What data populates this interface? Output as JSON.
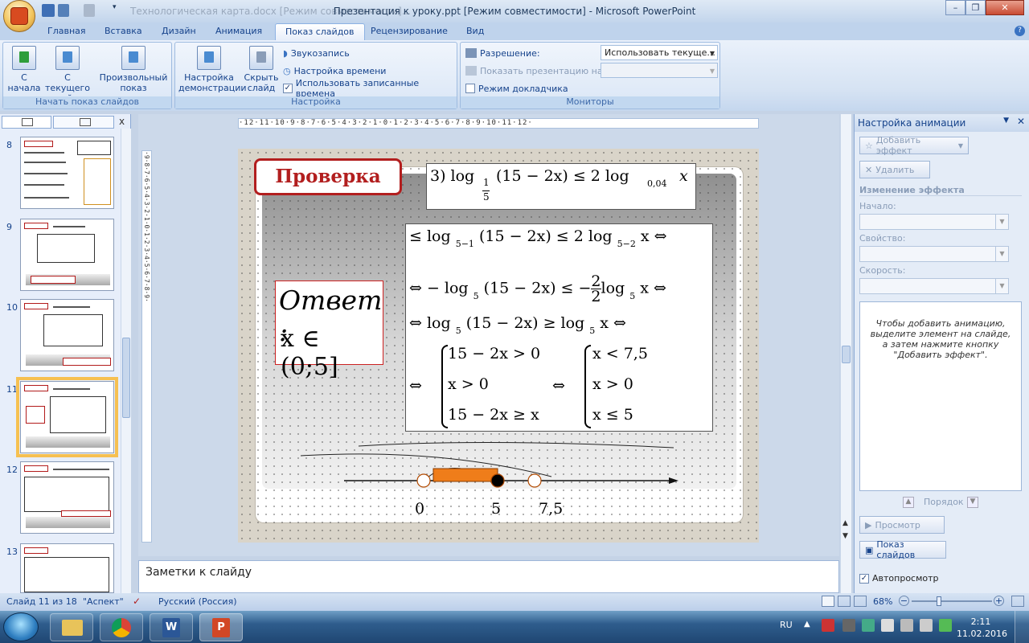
{
  "window": {
    "title": "Презентация к уроку.ppt [Режим совместимости] - Microsoft PowerPoint",
    "title_faded": "Технологическая карта.docx [Режим совместимости]..."
  },
  "tabs": [
    "Главная",
    "Вставка",
    "Дизайн",
    "Анимация",
    "Показ слайдов",
    "Рецензирование",
    "Вид"
  ],
  "active_tab": "Показ слайдов",
  "ribbon": {
    "group1": {
      "label": "Начать показ слайдов",
      "btn_from_start": "С\nначала",
      "btn_from_current": "С текущего\nслайда",
      "btn_custom": "Произвольный\nпоказ"
    },
    "group2": {
      "label": "Настройка",
      "btn_setup": "Настройка\nдемонстрации",
      "btn_hide": "Скрыть\nслайд",
      "record": "Звукозапись",
      "rehearse": "Настройка времени",
      "use_timings": "Использовать записанные времена",
      "use_timings_checked": true
    },
    "group3": {
      "label": "Мониторы",
      "resolution_label": "Разрешение:",
      "resolution_value": "Использовать текуще...",
      "show_on_label": "Показать презентацию на:",
      "presenter_view": "Режим докладчика"
    }
  },
  "slides_panel": {
    "tab1_icon": "slides-icon",
    "tab2_icon": "outline-icon",
    "close": "x",
    "items": [
      {
        "num": "8",
        "title": "Работа в парах"
      },
      {
        "num": "9",
        "title": "Проверка",
        "answer": "Ответ: x ∈(1;65)"
      },
      {
        "num": "10",
        "title": "Проверка",
        "answer": "Ответ: x ∈(4;\"3)"
      },
      {
        "num": "11",
        "title": "Проверка",
        "answer": "Ответ x ∈ (0;5]",
        "selected": true
      },
      {
        "num": "12",
        "title": "Проверка",
        "answer": "Ответ: x ∈[4;?]"
      },
      {
        "num": "13",
        "title": "Проверка"
      }
    ]
  },
  "ruler": {
    "top": "·12·11·10·9·8·7·6·5·4·3·2·1·0·1·2·3·4·5·6·7·8·9·10·11·12·",
    "left": "·9·8·7·6·5·4·3·2·1·0·1·2·3·4·5·6·7·8·9·"
  },
  "slide": {
    "title": "Проверка",
    "problem": {
      "prefix": "3) log",
      "base_num": "1",
      "base_den": "5",
      "arg": "(15 − 2x) ≤ 2 log",
      "base2": "0,04",
      "var": "x"
    },
    "steps": [
      {
        "pre": "≤ log ",
        "base": "5",
        "exp": "−1",
        "post": " (15 − 2x) ≤ 2 log ",
        "base2": "5",
        "exp2": "−2",
        "end": " x ⇔"
      },
      {
        "pre": "⇔ − log ",
        "base": "5",
        "post": " (15 − 2x) ≤ −",
        "frac_num": "2",
        "frac_den": "2",
        "post2": "log ",
        "base2": "5",
        "end": " x ⇔"
      },
      {
        "pre": "⇔ log ",
        "base": "5",
        "post": " (15 − 2x) ≥ log ",
        "base2": "5",
        "end": " x ⇔"
      }
    ],
    "system1": [
      "15 − 2x > 0",
      "x > 0",
      "15 − 2x ≥ x"
    ],
    "system2": [
      "x < 7,5",
      "x > 0",
      "x ≤ 5"
    ],
    "equiv": "⇔",
    "answer": {
      "title": "Ответ :",
      "value": "x ∈ (0;5]"
    },
    "numberline": {
      "points": [
        {
          "label": "0",
          "value": 0,
          "filled": false
        },
        {
          "label": "5",
          "value": 5,
          "filled": true
        },
        {
          "label": "7,5",
          "value": 7.5,
          "filled": false
        }
      ],
      "shaded_from": 0,
      "shaded_to": 5
    }
  },
  "notes": {
    "placeholder": "Заметки к слайду"
  },
  "anim_pane": {
    "title": "Настройка анимации",
    "add_effect": "Добавить эффект",
    "remove": "Удалить",
    "change_effect": "Изменение эффекта",
    "start_label": "Начало:",
    "property_label": "Свойство:",
    "speed_label": "Скорость:",
    "hint": "Чтобы добавить анимацию, выделите элемент на слайде, а затем нажмите кнопку \"Добавить эффект\".",
    "order": "Порядок",
    "preview": "Просмотр",
    "slideshow": "Показ слайдов",
    "autopreview": "Автопросмотр",
    "autopreview_checked": true
  },
  "status": {
    "slide": "Слайд 11 из 18",
    "theme": "\"Аспект\"",
    "language": "Русский (Россия)",
    "zoom": "68%",
    "zoom_level": 0.68
  },
  "taskbar": {
    "lang": "RU",
    "time": "2:11",
    "date": "11.02.2016"
  },
  "colors": {
    "accent_red": "#b21e1e",
    "ribbon_bg": "#d6e3f3",
    "shaded_bar": "#ef7d1a",
    "selection": "#f6c051"
  }
}
